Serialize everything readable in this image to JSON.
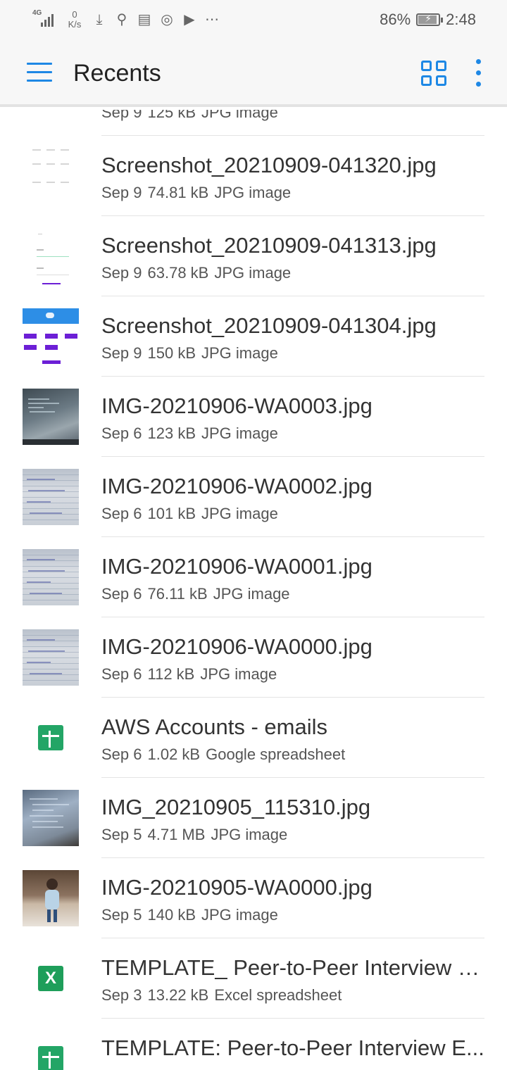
{
  "status_bar": {
    "network": "4G",
    "speed_value": "0",
    "speed_unit": "K/s",
    "icons": [
      "download-icon",
      "usb-icon",
      "card-icon",
      "whatsapp-icon",
      "play-store-icon",
      "more-notifications-icon"
    ],
    "battery_percent": "86%",
    "battery_level": 0.86,
    "time": "2:48"
  },
  "app_bar": {
    "title": "Recents",
    "accent_color": "#1e88e5"
  },
  "files": [
    {
      "name": "",
      "date": "Sep 9",
      "size": "125 kB",
      "type": "JPG image",
      "thumb": "screenshot-purple-button"
    },
    {
      "name": "Screenshot_20210909-041320.jpg",
      "date": "Sep 9",
      "size": "74.81 kB",
      "type": "JPG image",
      "thumb": "screenshot-faint-grid"
    },
    {
      "name": "Screenshot_20210909-041313.jpg",
      "date": "Sep 9",
      "size": "63.78 kB",
      "type": "JPG image",
      "thumb": "screenshot-form"
    },
    {
      "name": "Screenshot_20210909-041304.jpg",
      "date": "Sep 9",
      "size": "150 kB",
      "type": "JPG image",
      "thumb": "screenshot-blue-header"
    },
    {
      "name": "IMG-20210906-WA0003.jpg",
      "date": "Sep 6",
      "size": "123 kB",
      "type": "JPG image",
      "thumb": "photo-monitor"
    },
    {
      "name": "IMG-20210906-WA0002.jpg",
      "date": "Sep 6",
      "size": "101 kB",
      "type": "JPG image",
      "thumb": "photo-notebook"
    },
    {
      "name": "IMG-20210906-WA0001.jpg",
      "date": "Sep 6",
      "size": "76.11 kB",
      "type": "JPG image",
      "thumb": "photo-notebook"
    },
    {
      "name": "IMG-20210906-WA0000.jpg",
      "date": "Sep 6",
      "size": "112 kB",
      "type": "JPG image",
      "thumb": "photo-notebook"
    },
    {
      "name": "AWS Accounts - emails",
      "date": "Sep 6",
      "size": "1.02 kB",
      "type": "Google spreadsheet",
      "thumb": "google-sheets-icon"
    },
    {
      "name": "IMG_20210905_115310.jpg",
      "date": "Sep 5",
      "size": "4.71 MB",
      "type": "JPG image",
      "thumb": "photo-code-screen"
    },
    {
      "name": "IMG-20210905-WA0000.jpg",
      "date": "Sep 5",
      "size": "140 kB",
      "type": "JPG image",
      "thumb": "photo-child"
    },
    {
      "name": "TEMPLATE_ Peer-to-Peer Interview E...",
      "date": "Sep 3",
      "size": "13.22 kB",
      "type": "Excel spreadsheet",
      "thumb": "excel-icon"
    },
    {
      "name": "TEMPLATE: Peer-to-Peer Interview E...",
      "date": "",
      "size": "",
      "type": "",
      "thumb": "google-sheets-icon"
    }
  ],
  "icon_colors": {
    "google_sheets": "#23a566",
    "excel": "#1e9e5a",
    "screenshot_purple": "#6c1fd6",
    "screenshot_blue": "#2d8ee6"
  },
  "excel_glyph": "X"
}
